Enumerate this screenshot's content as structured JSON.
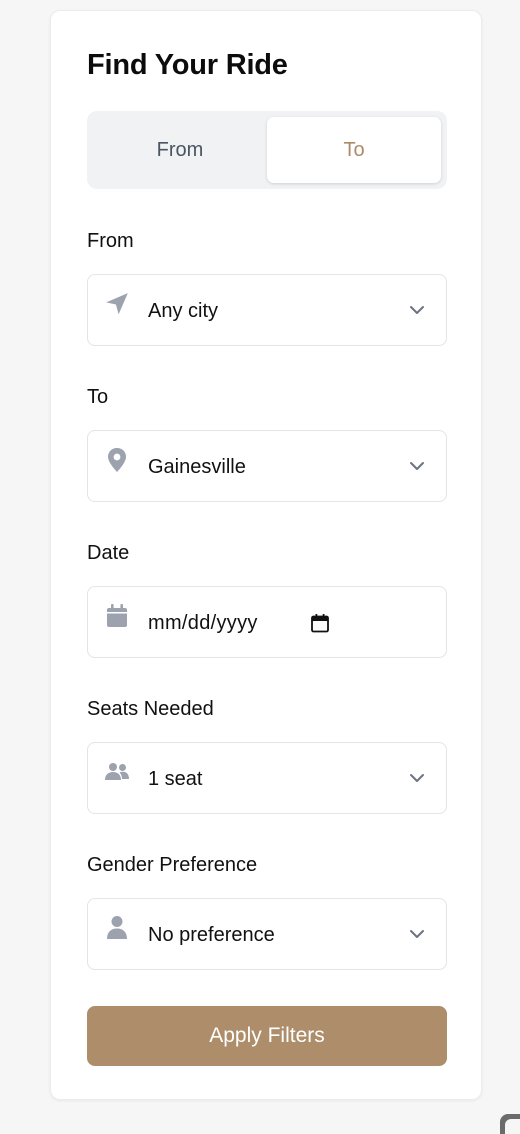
{
  "page": {
    "title": "Find Your Ride",
    "colors": {
      "accent": "#ad8d6a",
      "icon": "#9ca3af",
      "border": "#e4e4e7"
    }
  },
  "toggle": {
    "options": [
      {
        "label": "From",
        "selected": false
      },
      {
        "label": "To",
        "selected": true
      }
    ]
  },
  "fields": {
    "from": {
      "label": "From",
      "value": "Any city",
      "icon": "navigation-arrow-icon"
    },
    "to": {
      "label": "To",
      "value": "Gainesville",
      "icon": "map-pin-icon"
    },
    "date": {
      "label": "Date",
      "placeholder": "mm/dd/yyyy",
      "icon": "calendar-icon"
    },
    "seats": {
      "label": "Seats Needed",
      "value": "1 seat",
      "icon": "users-icon"
    },
    "gender": {
      "label": "Gender Preference",
      "value": "No preference",
      "icon": "user-icon"
    }
  },
  "actions": {
    "apply_label": "Apply Filters"
  }
}
